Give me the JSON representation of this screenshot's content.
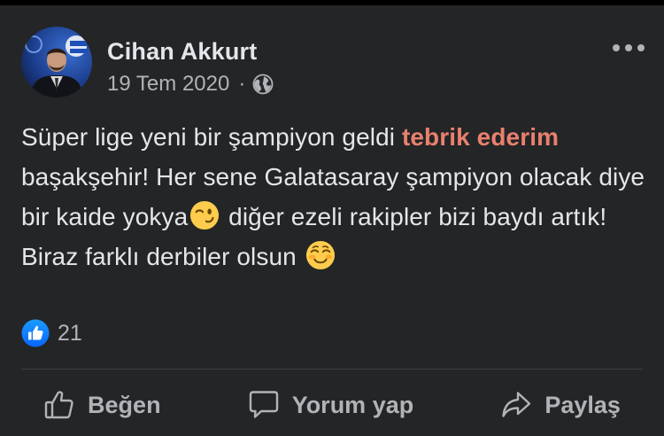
{
  "post": {
    "author": "Cihan Akkurt",
    "date": "19 Tem 2020",
    "separator": "·",
    "privacy_icon": "globe-icon",
    "text": {
      "part1": "Süper lige yeni bir şampiyon geldi ",
      "highlight": "tebrik ederim",
      "part2": " başakşehir! Her sene Galatasaray şampiyon olacak diye bir kaide yokya",
      "emoji1": "winking-face-emoji",
      "part3": " diğer ezeli rakipler bizi baydı artık! Biraz farklı derbiler olsun ",
      "emoji2": "smiling-face-emoji"
    },
    "reactions": {
      "icon": "like-badge-icon",
      "count": "21"
    }
  },
  "actions": {
    "like_label": "Beğen",
    "comment_label": "Yorum yap",
    "share_label": "Paylaş"
  },
  "colors": {
    "background": "#242526",
    "primary_text": "#e4e6eb",
    "secondary_text": "#b0b3b8",
    "highlight": "#e9806e",
    "like_blue": "#1877f2"
  }
}
